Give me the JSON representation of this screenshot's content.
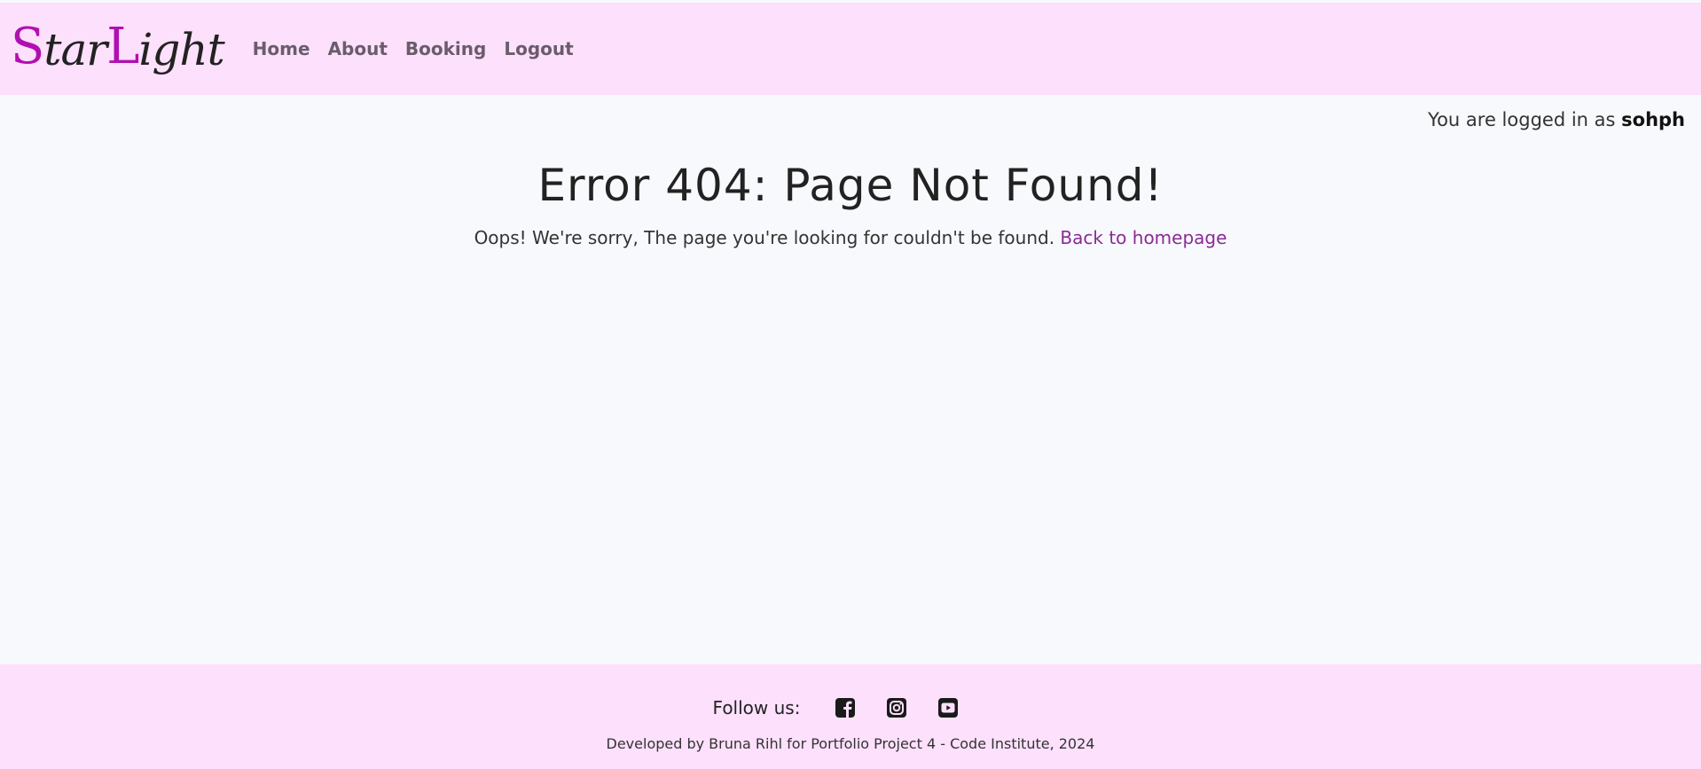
{
  "navbar": {
    "brand": {
      "cap1": "S",
      "part1": "tar",
      "cap2": "L",
      "part2": "ight"
    },
    "links": [
      {
        "label": "Home"
      },
      {
        "label": "About"
      },
      {
        "label": "Booking"
      },
      {
        "label": "Logout"
      }
    ]
  },
  "login_status": {
    "prefix": "You are logged in as ",
    "username": "sohph"
  },
  "main": {
    "title": "Error 404: Page Not Found!",
    "message": "Oops! We're sorry, The page you're looking for couldn't be found. ",
    "home_link": "Back to homepage"
  },
  "footer": {
    "follow_label": "Follow us:",
    "social_icons": [
      "facebook-icon",
      "instagram-icon",
      "youtube-icon"
    ],
    "credits": "Developed by Bruna Rihl for Portfolio Project 4 - Code Institute, 2024"
  },
  "colors": {
    "navbar_bg": "#fce0fc",
    "brand_accent": "#b10fb1",
    "link_accent": "#8a2b95",
    "page_bg": "#f8f9fc"
  }
}
